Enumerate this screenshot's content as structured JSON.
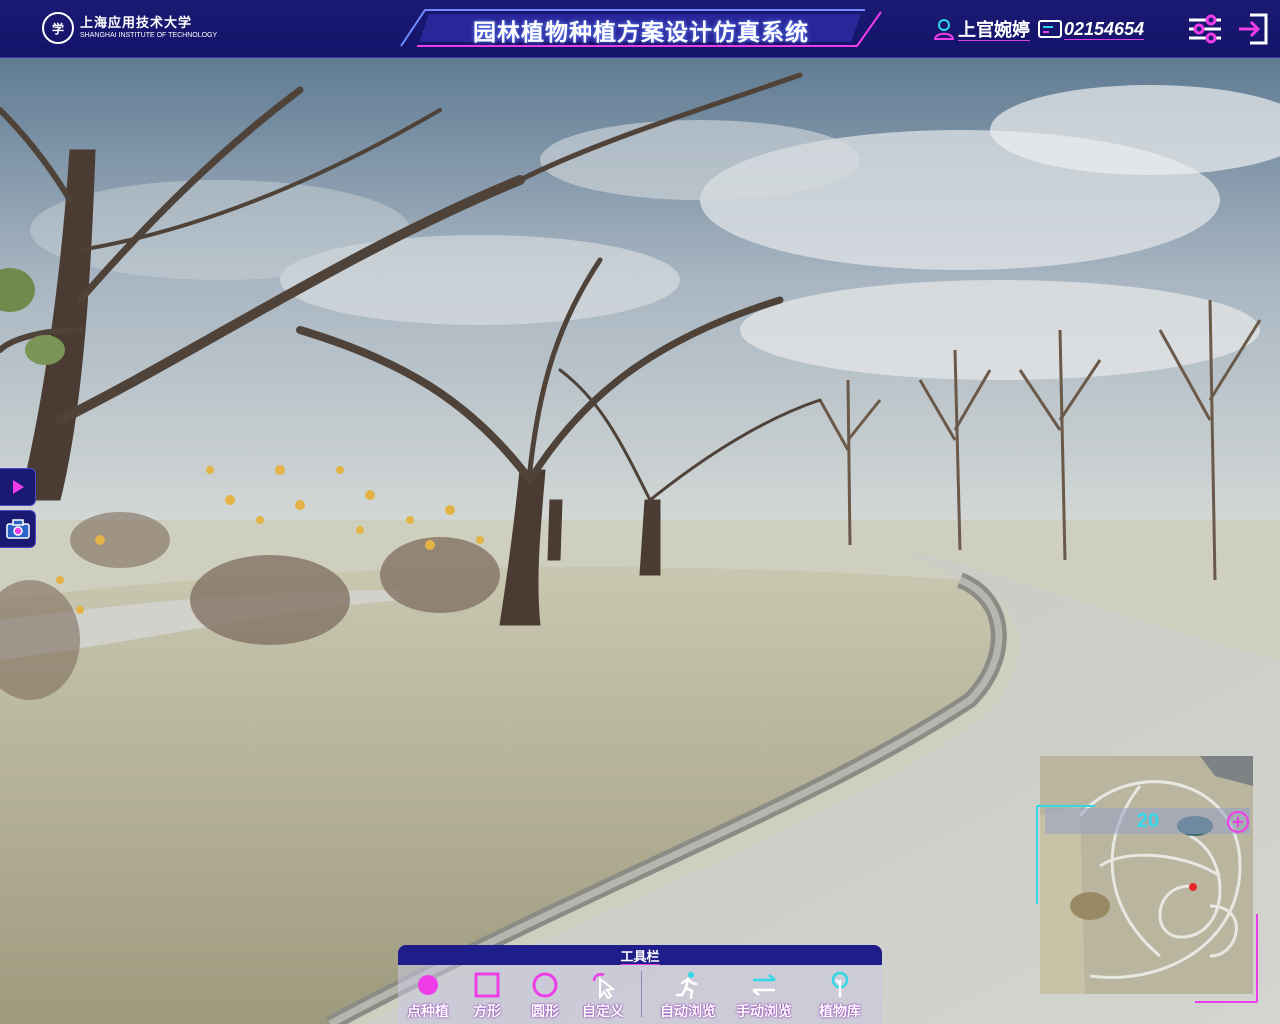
{
  "header": {
    "school_cn": "上海应用技术大学",
    "school_en": "SHANGHAI INSTITUTE OF TECHNOLOGY",
    "seal_text": "学",
    "title": "园林植物种植方案设计仿真系统",
    "user_name": "上官婉婷",
    "student_id": "02154654",
    "settings_icon": "sliders-icon",
    "logout_icon": "logout-icon"
  },
  "side": {
    "play_icon": "play-icon",
    "camera_icon": "camera-icon"
  },
  "minimap": {
    "zoom_value": "20",
    "zoom_in_label": "+"
  },
  "toolbar": {
    "title": "工具栏",
    "tools": [
      {
        "label": "点种植",
        "icon": "filled-circle-icon"
      },
      {
        "label": "方形",
        "icon": "square-icon"
      },
      {
        "label": "圆形",
        "icon": "circle-icon"
      },
      {
        "label": "自定义",
        "icon": "pointer-icon"
      },
      {
        "label": "自动浏览",
        "icon": "running-person-icon"
      },
      {
        "label": "手动浏览",
        "icon": "swap-arrows-icon"
      },
      {
        "label": "植物库",
        "icon": "tree-icon"
      }
    ]
  },
  "colors": {
    "header_bg": "#1b1a72",
    "accent_magenta": "#ee3ce8",
    "accent_cyan": "#32d7e8"
  }
}
